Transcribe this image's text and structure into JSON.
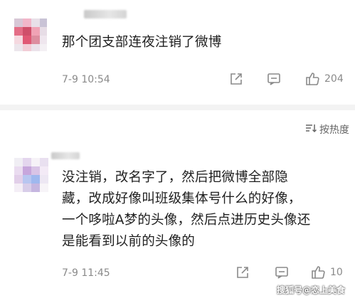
{
  "comments": [
    {
      "text": "那个团支部连夜注销了微博",
      "time": "7-9 10:54",
      "likes": "204"
    },
    {
      "text_lines": [
        "没注销，改名字了，然后把微博全部隐",
        "藏，改成好像叫班级集体号什么的好像，",
        "一个哆啦A梦的头像，然后点进历史头像还",
        "是能看到以前的头像的"
      ],
      "time": "7-9 11:45",
      "likes": "10"
    }
  ],
  "sort": {
    "label": "按热度"
  },
  "watermark": "搜狐号@恋上美食",
  "icons": {
    "share": "share-icon",
    "comment": "comment-icon",
    "like": "thumbs-up-icon",
    "sort": "sort-icon"
  }
}
